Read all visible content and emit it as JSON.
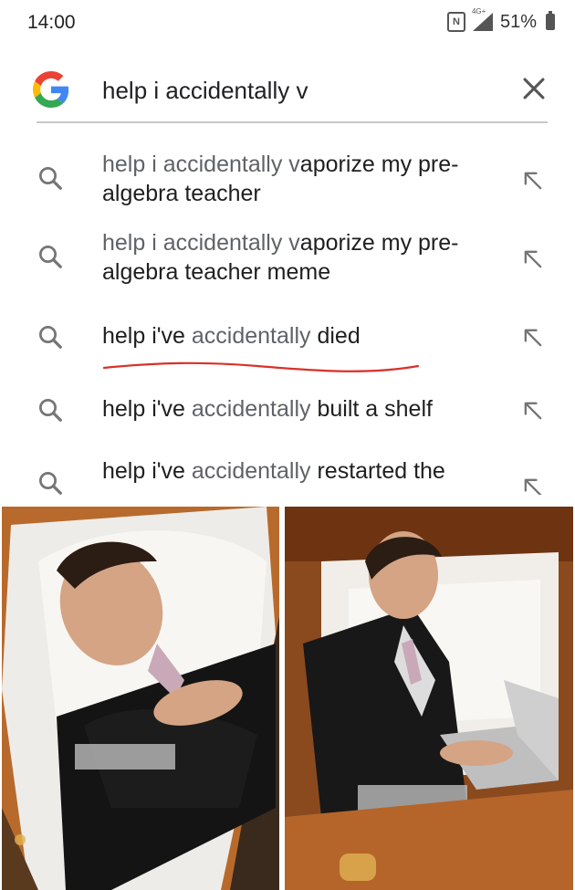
{
  "status_bar": {
    "time": "14:00",
    "nfc": "N",
    "network": "4G+",
    "battery": "51%"
  },
  "search": {
    "query": "help i accidentally v"
  },
  "suggestions": [
    {
      "prefix": "help i accidentally v",
      "completion": "aporize my pre-algebra teacher"
    },
    {
      "prefix": "help i accidentally v",
      "completion": "aporize my pre-algebra teacher meme"
    },
    {
      "prefix_plain": "help i've ",
      "prefix_dim": "accidentally",
      "completion": " died"
    },
    {
      "prefix_plain": "help i've ",
      "prefix_dim": "accidentally",
      "completion": " built a shelf"
    },
    {
      "prefix_plain": "help i've ",
      "prefix_dim": "accidentally",
      "completion": " restarted the"
    }
  ],
  "colors": {
    "google_blue": "#4285F4",
    "google_red": "#EA4335",
    "google_yellow": "#FBBC05",
    "google_green": "#34A853",
    "annotation_red": "#d9312b"
  }
}
